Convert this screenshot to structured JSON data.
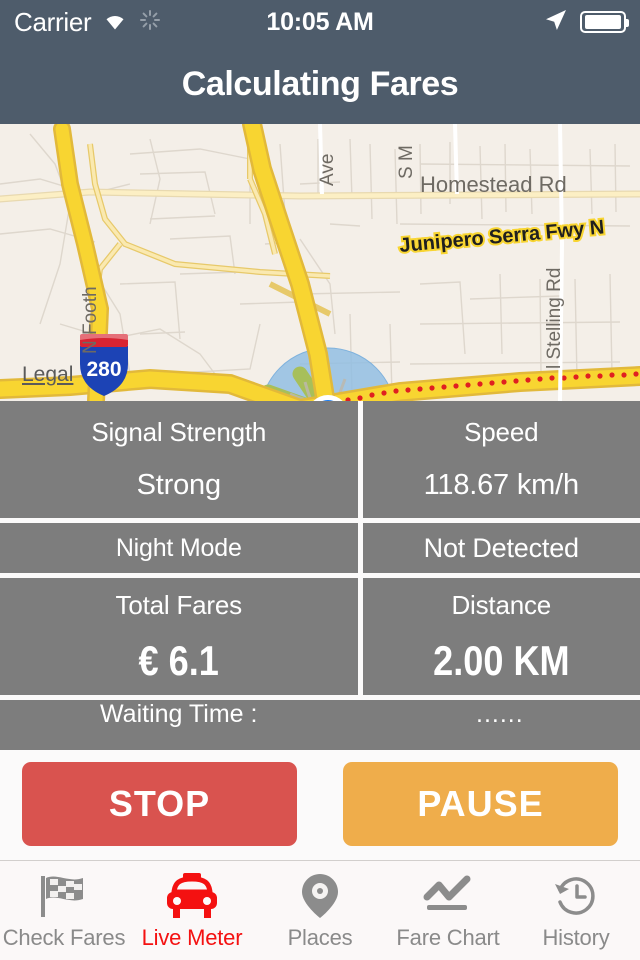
{
  "statusbar": {
    "carrier": "Carrier",
    "time": "10:05 AM",
    "wifi_icon": "wifi-icon",
    "activity_icon": "activity-spinner-icon",
    "location_icon": "location-arrow-icon",
    "battery_icon": "battery-full-icon"
  },
  "navbar": {
    "title": "Calculating Fares"
  },
  "map": {
    "legal_label": "Legal",
    "labels": {
      "interstate_shield": "280",
      "homestead": "Homestead Rd",
      "freeway": "Junipero Serra Fwy N",
      "foothill": "N Foothill",
      "stelling": "N Stelling Rd",
      "ave": "Ave",
      "sm": "S M"
    },
    "colors": {
      "land": "#f4efe8",
      "highway": "#f7d832",
      "arterial": "#fbe9a8",
      "accuracy_circle": "#89b8e0",
      "user_dot": "#1a7cf0"
    }
  },
  "panels": {
    "signal_strength": {
      "label": "Signal Strength",
      "value": "Strong"
    },
    "speed": {
      "label": "Speed",
      "value": "118.67 km/h"
    },
    "night_mode": {
      "label": "Night Mode",
      "value": "Not Detected"
    },
    "total_fares": {
      "label": "Total Fares",
      "value": "€ 6.1"
    },
    "distance": {
      "label": "Distance",
      "value": "2.00 KM"
    },
    "waiting_time": {
      "label": "Waiting Time :",
      "value": "......"
    }
  },
  "actions": {
    "stop_label": "STOP",
    "stop_color": "#d9534f",
    "pause_label": "PAUSE",
    "pause_color": "#efad4b"
  },
  "tabbar": {
    "active_color": "#f41111",
    "inactive_color": "#8a8a8a",
    "items": [
      {
        "label": "Check Fares",
        "icon": "checkered-flag-icon",
        "active": false
      },
      {
        "label": "Live Meter",
        "icon": "taxi-car-icon",
        "active": true
      },
      {
        "label": "Places",
        "icon": "map-pin-icon",
        "active": false
      },
      {
        "label": "Fare Chart",
        "icon": "line-chart-icon",
        "active": false
      },
      {
        "label": "History",
        "icon": "clock-rewind-icon",
        "active": false
      }
    ]
  }
}
